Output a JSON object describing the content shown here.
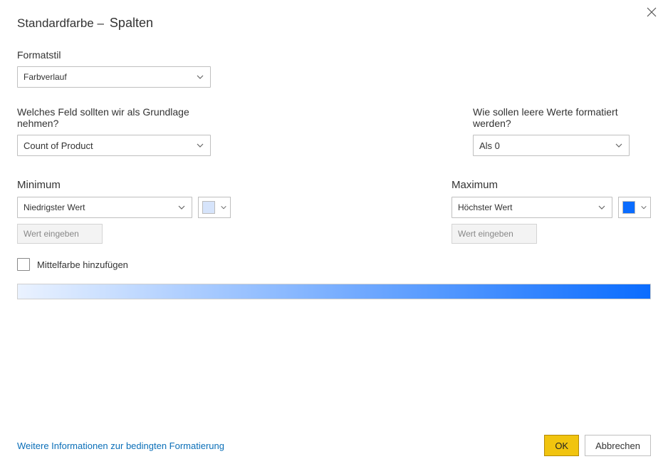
{
  "title": {
    "prefix": "Standardfarbe –",
    "main": "Spalten"
  },
  "format_style": {
    "label": "Formatstil",
    "value": "Farbverlauf"
  },
  "basis_field": {
    "label": "Welches Feld sollten wir als Grundlage nehmen?",
    "value": "Count of Product"
  },
  "empty_values": {
    "label": "Wie sollen leere Werte formatiert werden?",
    "value": "Als 0"
  },
  "minimum": {
    "label": "Minimum",
    "dropdown": "Niedrigster Wert",
    "placeholder": "Wert eingeben",
    "color": "#d6e4fb"
  },
  "maximum": {
    "label": "Maximum",
    "dropdown": "Höchster Wert",
    "placeholder": "Wert eingeben",
    "color": "#0a6cff"
  },
  "middle_checkbox": {
    "label": "Mittelfarbe hinzufügen",
    "checked": false
  },
  "gradient": {
    "start": "#eaf2ff",
    "end": "#0a6cff"
  },
  "footer": {
    "link": "Weitere Informationen zur bedingten Formatierung",
    "ok": "OK",
    "cancel": "Abbrechen"
  }
}
